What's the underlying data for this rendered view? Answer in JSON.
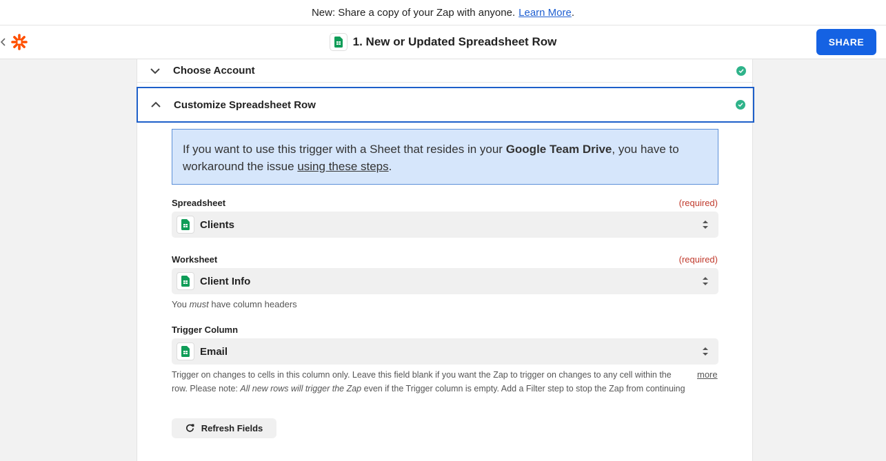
{
  "banner": {
    "text": "New: Share a copy of your Zap with anyone.",
    "link": "Learn More",
    "period": "."
  },
  "header": {
    "title": "1. New or Updated Spreadsheet Row",
    "share_label": "SHARE"
  },
  "sections": [
    {
      "title": "Choose Account",
      "state": "collapsed",
      "complete": true
    },
    {
      "title": "Customize Spreadsheet Row",
      "state": "expanded",
      "complete": true
    }
  ],
  "info": {
    "part1": "If you want to use this trigger with a Sheet that resides in your ",
    "bold": "Google Team Drive",
    "part2": ", you have to workaround the issue ",
    "link": "using these steps",
    "part3": "."
  },
  "fields": {
    "spreadsheet": {
      "label": "Spreadsheet",
      "required": "(required)",
      "value": "Clients"
    },
    "worksheet": {
      "label": "Worksheet",
      "required": "(required)",
      "value": "Client Info",
      "help_pre": "You ",
      "help_em": "must",
      "help_post": " have column headers"
    },
    "trigger_column": {
      "label": "Trigger Column",
      "value": "Email",
      "help_line1": "Trigger on changes to cells in this column only. Leave this field blank if you want the Zap to trigger on changes to any cell within the",
      "help_line2_pre": "row. Please note: ",
      "help_line2_em": "All new rows will trigger the Zap",
      "help_line2_post": " even if the Trigger column is empty. Add a Filter step to stop the Zap from continuing",
      "more": "more"
    }
  },
  "refresh_label": "Refresh Fields",
  "colors": {
    "accent": "#1562e3",
    "success": "#2fb38a",
    "required": "#c0392b",
    "info_bg": "#d6e6fb",
    "zapier_orange": "#ff4f00",
    "sheets_green": "#0f9d58"
  }
}
